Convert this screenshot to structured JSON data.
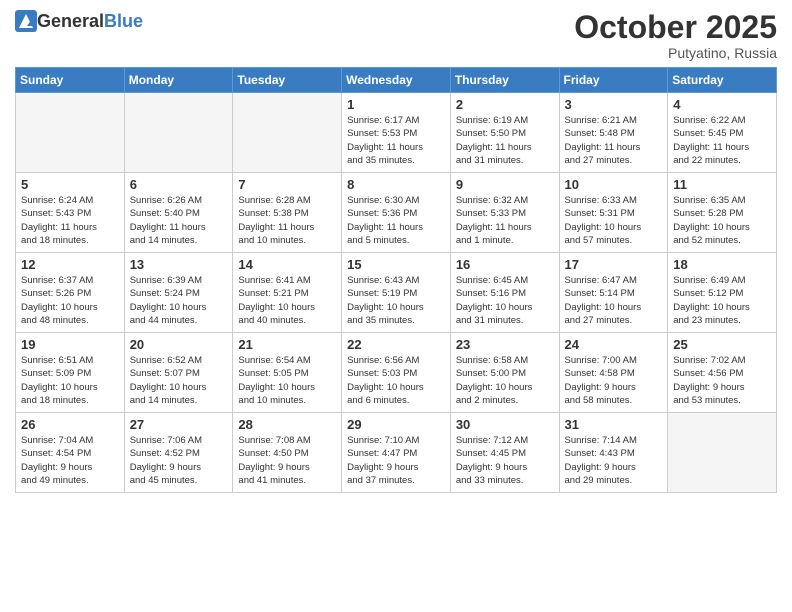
{
  "header": {
    "logo_general": "General",
    "logo_blue": "Blue",
    "month": "October 2025",
    "location": "Putyatino, Russia"
  },
  "weekdays": [
    "Sunday",
    "Monday",
    "Tuesday",
    "Wednesday",
    "Thursday",
    "Friday",
    "Saturday"
  ],
  "weeks": [
    [
      {
        "day": "",
        "info": ""
      },
      {
        "day": "",
        "info": ""
      },
      {
        "day": "",
        "info": ""
      },
      {
        "day": "1",
        "info": "Sunrise: 6:17 AM\nSunset: 5:53 PM\nDaylight: 11 hours\nand 35 minutes."
      },
      {
        "day": "2",
        "info": "Sunrise: 6:19 AM\nSunset: 5:50 PM\nDaylight: 11 hours\nand 31 minutes."
      },
      {
        "day": "3",
        "info": "Sunrise: 6:21 AM\nSunset: 5:48 PM\nDaylight: 11 hours\nand 27 minutes."
      },
      {
        "day": "4",
        "info": "Sunrise: 6:22 AM\nSunset: 5:45 PM\nDaylight: 11 hours\nand 22 minutes."
      }
    ],
    [
      {
        "day": "5",
        "info": "Sunrise: 6:24 AM\nSunset: 5:43 PM\nDaylight: 11 hours\nand 18 minutes."
      },
      {
        "day": "6",
        "info": "Sunrise: 6:26 AM\nSunset: 5:40 PM\nDaylight: 11 hours\nand 14 minutes."
      },
      {
        "day": "7",
        "info": "Sunrise: 6:28 AM\nSunset: 5:38 PM\nDaylight: 11 hours\nand 10 minutes."
      },
      {
        "day": "8",
        "info": "Sunrise: 6:30 AM\nSunset: 5:36 PM\nDaylight: 11 hours\nand 5 minutes."
      },
      {
        "day": "9",
        "info": "Sunrise: 6:32 AM\nSunset: 5:33 PM\nDaylight: 11 hours\nand 1 minute."
      },
      {
        "day": "10",
        "info": "Sunrise: 6:33 AM\nSunset: 5:31 PM\nDaylight: 10 hours\nand 57 minutes."
      },
      {
        "day": "11",
        "info": "Sunrise: 6:35 AM\nSunset: 5:28 PM\nDaylight: 10 hours\nand 52 minutes."
      }
    ],
    [
      {
        "day": "12",
        "info": "Sunrise: 6:37 AM\nSunset: 5:26 PM\nDaylight: 10 hours\nand 48 minutes."
      },
      {
        "day": "13",
        "info": "Sunrise: 6:39 AM\nSunset: 5:24 PM\nDaylight: 10 hours\nand 44 minutes."
      },
      {
        "day": "14",
        "info": "Sunrise: 6:41 AM\nSunset: 5:21 PM\nDaylight: 10 hours\nand 40 minutes."
      },
      {
        "day": "15",
        "info": "Sunrise: 6:43 AM\nSunset: 5:19 PM\nDaylight: 10 hours\nand 35 minutes."
      },
      {
        "day": "16",
        "info": "Sunrise: 6:45 AM\nSunset: 5:16 PM\nDaylight: 10 hours\nand 31 minutes."
      },
      {
        "day": "17",
        "info": "Sunrise: 6:47 AM\nSunset: 5:14 PM\nDaylight: 10 hours\nand 27 minutes."
      },
      {
        "day": "18",
        "info": "Sunrise: 6:49 AM\nSunset: 5:12 PM\nDaylight: 10 hours\nand 23 minutes."
      }
    ],
    [
      {
        "day": "19",
        "info": "Sunrise: 6:51 AM\nSunset: 5:09 PM\nDaylight: 10 hours\nand 18 minutes."
      },
      {
        "day": "20",
        "info": "Sunrise: 6:52 AM\nSunset: 5:07 PM\nDaylight: 10 hours\nand 14 minutes."
      },
      {
        "day": "21",
        "info": "Sunrise: 6:54 AM\nSunset: 5:05 PM\nDaylight: 10 hours\nand 10 minutes."
      },
      {
        "day": "22",
        "info": "Sunrise: 6:56 AM\nSunset: 5:03 PM\nDaylight: 10 hours\nand 6 minutes."
      },
      {
        "day": "23",
        "info": "Sunrise: 6:58 AM\nSunset: 5:00 PM\nDaylight: 10 hours\nand 2 minutes."
      },
      {
        "day": "24",
        "info": "Sunrise: 7:00 AM\nSunset: 4:58 PM\nDaylight: 9 hours\nand 58 minutes."
      },
      {
        "day": "25",
        "info": "Sunrise: 7:02 AM\nSunset: 4:56 PM\nDaylight: 9 hours\nand 53 minutes."
      }
    ],
    [
      {
        "day": "26",
        "info": "Sunrise: 7:04 AM\nSunset: 4:54 PM\nDaylight: 9 hours\nand 49 minutes."
      },
      {
        "day": "27",
        "info": "Sunrise: 7:06 AM\nSunset: 4:52 PM\nDaylight: 9 hours\nand 45 minutes."
      },
      {
        "day": "28",
        "info": "Sunrise: 7:08 AM\nSunset: 4:50 PM\nDaylight: 9 hours\nand 41 minutes."
      },
      {
        "day": "29",
        "info": "Sunrise: 7:10 AM\nSunset: 4:47 PM\nDaylight: 9 hours\nand 37 minutes."
      },
      {
        "day": "30",
        "info": "Sunrise: 7:12 AM\nSunset: 4:45 PM\nDaylight: 9 hours\nand 33 minutes."
      },
      {
        "day": "31",
        "info": "Sunrise: 7:14 AM\nSunset: 4:43 PM\nDaylight: 9 hours\nand 29 minutes."
      },
      {
        "day": "",
        "info": ""
      }
    ]
  ]
}
